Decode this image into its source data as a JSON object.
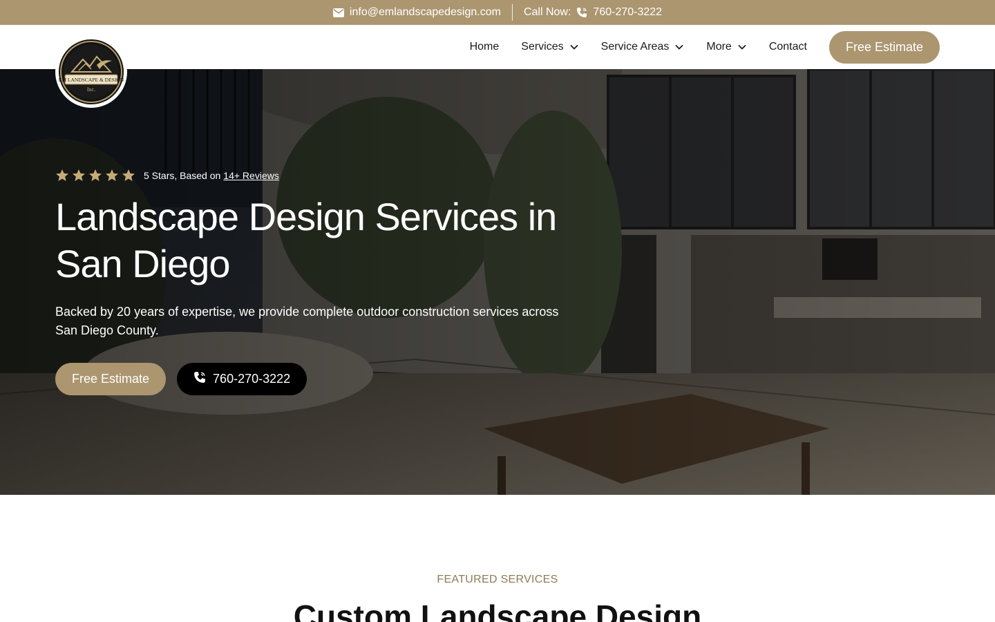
{
  "colors": {
    "accent": "#ac9670",
    "dark": "#000000",
    "hero_overlay": "#2e2a25"
  },
  "topbar": {
    "email": "info@emlandscapedesign.com",
    "call_label": "Call Now:",
    "phone": "760-270-3222",
    "icons": [
      "envelope-icon",
      "phone-icon"
    ]
  },
  "logo": {
    "line1": "EM LANDSCAPE & DESIGN",
    "line2": "Inc."
  },
  "nav": {
    "items": [
      {
        "label": "Home",
        "dropdown": false
      },
      {
        "label": "Services",
        "dropdown": true
      },
      {
        "label": "Service Areas",
        "dropdown": true
      },
      {
        "label": "More",
        "dropdown": true
      },
      {
        "label": "Contact",
        "dropdown": false
      }
    ],
    "cta": "Free Estimate"
  },
  "hero": {
    "rating": {
      "stars": 5,
      "text": "5 Stars, Based on",
      "link": "14+ Reviews"
    },
    "title": "Landscape Design Services in San Diego",
    "subtitle": "Backed by 20 years of expertise, we provide complete outdoor construction services across San Diego County.",
    "primary_button": "Free Estimate",
    "phone_button": "760-270-3222"
  },
  "featured": {
    "kicker": "FEATURED SERVICES",
    "title": "Custom Landscape Design"
  }
}
